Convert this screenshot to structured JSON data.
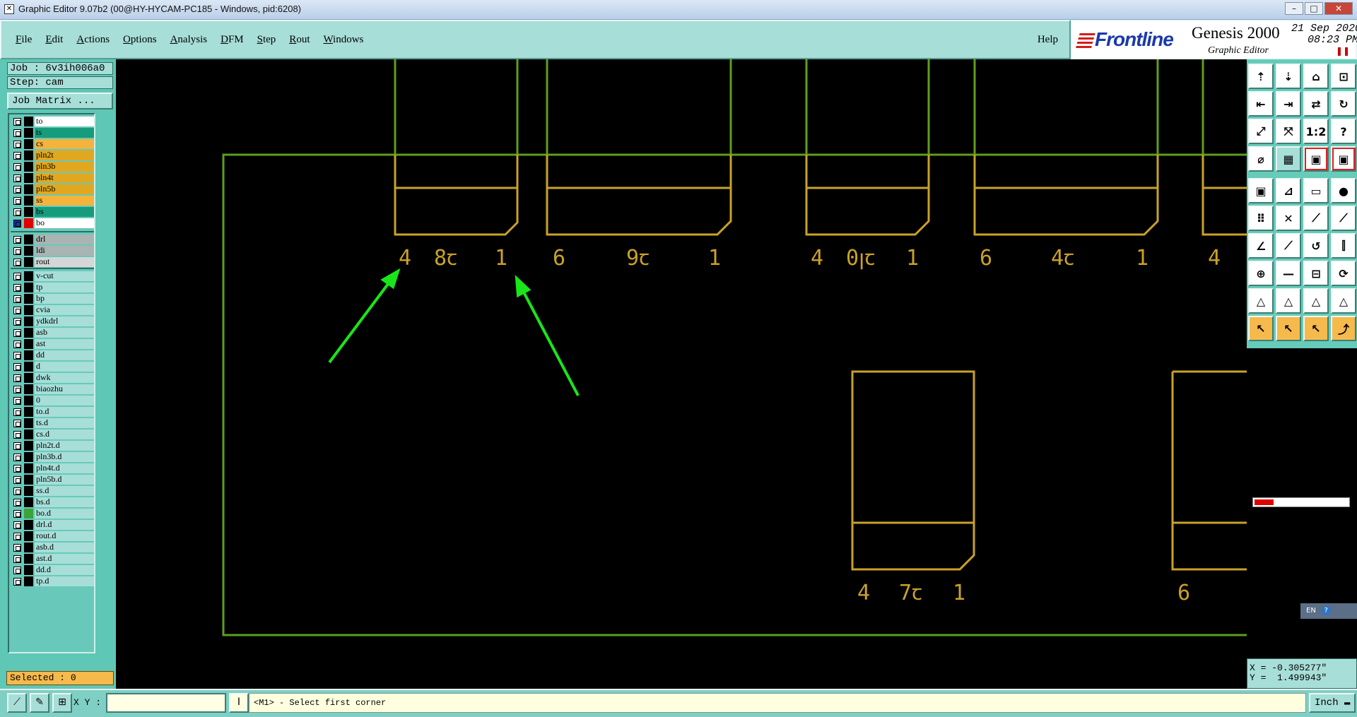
{
  "window": {
    "title": "Graphic Editor 9.07b2 (00@HY-HYCAM-PC185 - Windows, pid:6208)",
    "controls": [
      "–",
      "□",
      "✕"
    ]
  },
  "menubar": {
    "items": [
      "File",
      "Edit",
      "Actions",
      "Options",
      "Analysis",
      "DFM",
      "Step",
      "Rout",
      "Windows"
    ],
    "help": "Help"
  },
  "brand": {
    "logo": "Frontline",
    "product": "Genesis 2000",
    "subtitle": "Graphic Editor",
    "date": "21 Sep 2020\n08:23 PM",
    "pause_icon": "pause-icon"
  },
  "job": {
    "job": "Job : 6v3ih006a0",
    "step": "Step: cam",
    "job_matrix": "Job Matrix ..."
  },
  "layers": {
    "group1": [
      {
        "name": "to",
        "color": "#ffffff"
      },
      {
        "name": "ts",
        "color": "#169c7c"
      },
      {
        "name": "cs",
        "color": "#f4b33b"
      },
      {
        "name": "pln2t",
        "color": "#e1a81f"
      },
      {
        "name": "pln3b",
        "color": "#e1a81f"
      },
      {
        "name": "pln4t",
        "color": "#e1a81f"
      },
      {
        "name": "pln5b",
        "color": "#e1a81f"
      },
      {
        "name": "ss",
        "color": "#f4b33b"
      },
      {
        "name": "bs",
        "color": "#169c7c"
      },
      {
        "name": "bo",
        "color": "#ffffff",
        "active": true
      }
    ],
    "group2": [
      {
        "name": "drl",
        "color": "#aab4b2"
      },
      {
        "name": "ldi",
        "color": "#aab4b2"
      },
      {
        "name": "rout",
        "color": "#d6d6d6"
      }
    ],
    "group3": [
      {
        "name": "v-cut",
        "color": "#a7ded8"
      },
      {
        "name": "tp",
        "color": "#a7ded8"
      },
      {
        "name": "bp",
        "color": "#a7ded8"
      },
      {
        "name": "cvia",
        "color": "#a7ded8"
      },
      {
        "name": "ydkdrl",
        "color": "#a7ded8"
      },
      {
        "name": "asb",
        "color": "#a7ded8"
      },
      {
        "name": "ast",
        "color": "#a7ded8"
      },
      {
        "name": "dd",
        "color": "#a7ded8"
      },
      {
        "name": "d",
        "color": "#a7ded8"
      },
      {
        "name": "dwk",
        "color": "#a7ded8"
      },
      {
        "name": "biaozhu",
        "color": "#a7ded8"
      },
      {
        "name": "0",
        "color": "#a7ded8"
      },
      {
        "name": "to.d",
        "color": "#a7ded8"
      },
      {
        "name": "ts.d",
        "color": "#a7ded8"
      },
      {
        "name": "cs.d",
        "color": "#a7ded8"
      },
      {
        "name": "pln2t.d",
        "color": "#a7ded8"
      },
      {
        "name": "pln3b.d",
        "color": "#a7ded8"
      },
      {
        "name": "pln4t.d",
        "color": "#a7ded8"
      },
      {
        "name": "pln5b.d",
        "color": "#a7ded8"
      },
      {
        "name": "ss.d",
        "color": "#a7ded8"
      },
      {
        "name": "bs.d",
        "color": "#a7ded8"
      },
      {
        "name": "bo.d",
        "color": "#a7ded8",
        "swatch": "#3aa33a"
      },
      {
        "name": "drl.d",
        "color": "#a7ded8"
      },
      {
        "name": "rout.d",
        "color": "#a7ded8"
      },
      {
        "name": "asb.d",
        "color": "#a7ded8"
      },
      {
        "name": "ast.d",
        "color": "#a7ded8"
      },
      {
        "name": "dd.d",
        "color": "#a7ded8"
      },
      {
        "name": "tp.d",
        "color": "#a7ded8"
      }
    ]
  },
  "selected": "Selected : 0",
  "canvas": {
    "labels": [
      {
        "id": "l1",
        "text": "4"
      },
      {
        "id": "l2",
        "text": "8ꞇ"
      },
      {
        "id": "l3",
        "text": "1"
      },
      {
        "id": "l4",
        "text": "6"
      },
      {
        "id": "l5",
        "text": "9ꞇ"
      },
      {
        "id": "l6",
        "text": "1"
      },
      {
        "id": "l7",
        "text": "4"
      },
      {
        "id": "l8",
        "text": "0ꞁꞇ"
      },
      {
        "id": "l9",
        "text": "1"
      },
      {
        "id": "l10",
        "text": "6"
      },
      {
        "id": "l11",
        "text": "4ꞇ"
      },
      {
        "id": "l12",
        "text": "1"
      },
      {
        "id": "l13",
        "text": "4"
      },
      {
        "id": "l14",
        "text": "4"
      },
      {
        "id": "l15",
        "text": "7ꞇ"
      },
      {
        "id": "l16",
        "text": "1"
      },
      {
        "id": "l17",
        "text": "6"
      }
    ],
    "colors": {
      "outline": "#5e9e1e",
      "pad": "#c9a227",
      "arrow": "#19e619"
    }
  },
  "tools": {
    "icons": [
      "page-up-icon",
      "page-down-icon",
      "home-icon",
      "fit-icon",
      "left-icon",
      "right-icon",
      "swap-icon",
      "sync-icon",
      "zoom-fit-icon",
      "zoom-all-icon",
      "ratio-icon",
      "help-icon",
      "measure-icon",
      "grid-icon",
      "snap-icon",
      "snap2-icon",
      "pad-icon",
      "line-icon",
      "ruler-icon",
      "dot-icon",
      "nodes-icon",
      "cross-icon",
      "connect-icon",
      "connect2-icon",
      "angle-icon",
      "slope-icon",
      "arc-icon",
      "split-icon",
      "move-icon",
      "cut-icon",
      "mirror-icon",
      "rotate-icon",
      "tri1-icon",
      "tri2-icon",
      "tri3-icon",
      "tri4-icon",
      "pointer-icon",
      "pointer2-icon",
      "pointer3-icon",
      "path-icon"
    ],
    "ratio_label": "1:2"
  },
  "progress": 0.2,
  "lang": {
    "code": "EN",
    "help": "?"
  },
  "coords": "X = -0.305277\"\nY =  1.499943\"",
  "bottom": {
    "xy_label": "X Y :",
    "xy_value": "",
    "message": "<M1> - Select first corner",
    "units": "Inch ▬"
  }
}
